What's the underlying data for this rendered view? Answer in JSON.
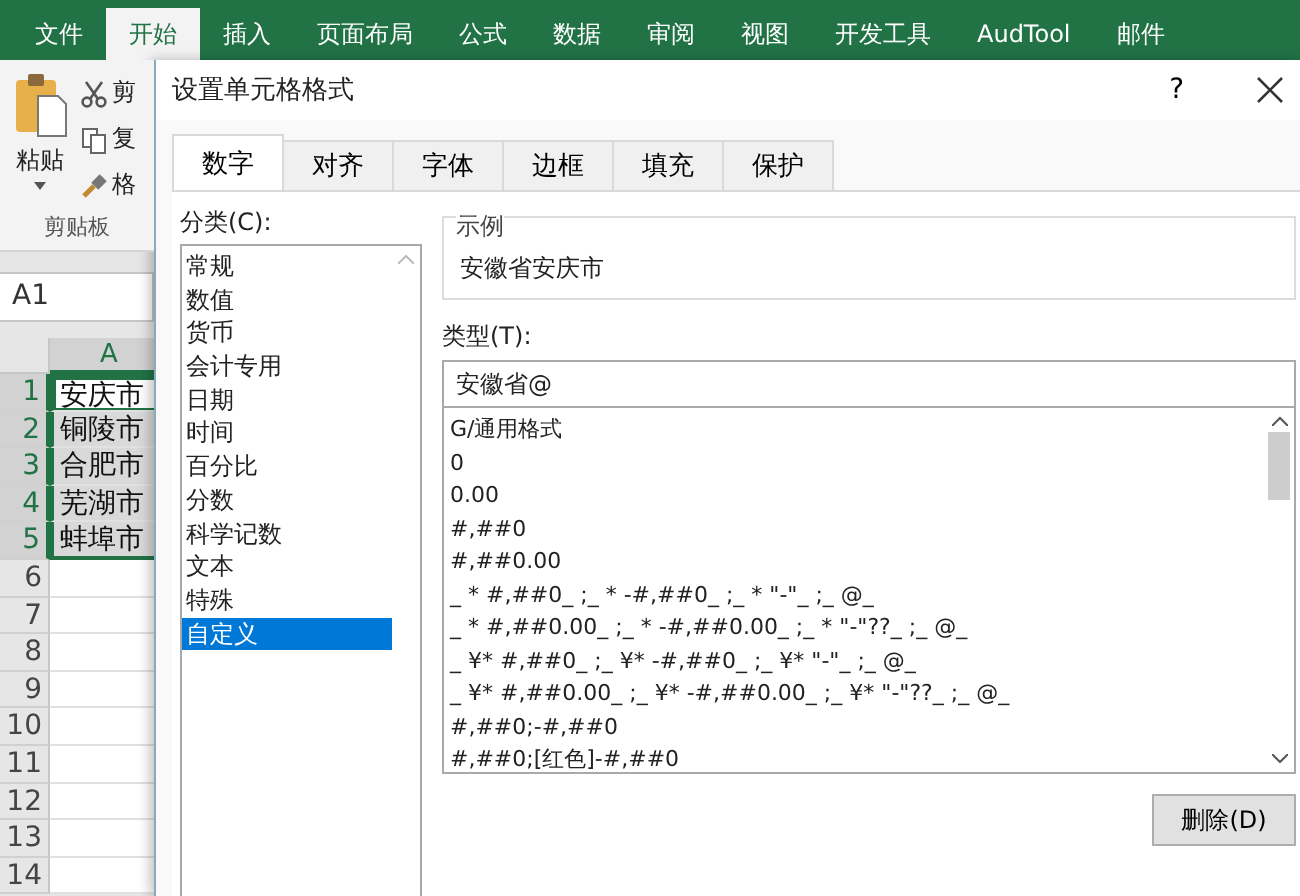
{
  "ribbon": {
    "tabs": [
      {
        "label": "文件",
        "selected": false
      },
      {
        "label": "开始",
        "selected": true
      },
      {
        "label": "插入",
        "selected": false
      },
      {
        "label": "页面布局",
        "selected": false
      },
      {
        "label": "公式",
        "selected": false
      },
      {
        "label": "数据",
        "selected": false
      },
      {
        "label": "审阅",
        "selected": false
      },
      {
        "label": "视图",
        "selected": false
      },
      {
        "label": "开发工具",
        "selected": false
      },
      {
        "label": "AudTool",
        "selected": false
      },
      {
        "label": "邮件",
        "selected": false
      }
    ],
    "clipboard": {
      "paste": "粘贴",
      "items": [
        {
          "kind": "cut",
          "label": "剪"
        },
        {
          "kind": "copy",
          "label": "复"
        },
        {
          "kind": "format",
          "label": "格"
        }
      ],
      "group": "剪贴板"
    }
  },
  "name_box": "A1",
  "sheet": {
    "column": "A",
    "rows": [
      {
        "number": "1",
        "value": "安庆市",
        "selected": true,
        "active": true
      },
      {
        "number": "2",
        "value": "铜陵市",
        "selected": true,
        "active": false
      },
      {
        "number": "3",
        "value": "合肥市",
        "selected": true,
        "active": false
      },
      {
        "number": "4",
        "value": "芜湖市",
        "selected": true,
        "active": false
      },
      {
        "number": "5",
        "value": "蚌埠市",
        "selected": true,
        "active": false
      },
      {
        "number": "6",
        "selected": false,
        "active": false
      },
      {
        "number": "7",
        "selected": false,
        "active": false
      },
      {
        "number": "8",
        "selected": false,
        "active": false
      },
      {
        "number": "9",
        "selected": false,
        "active": false
      },
      {
        "number": "10",
        "selected": false,
        "active": false
      },
      {
        "number": "11",
        "selected": false,
        "active": false
      },
      {
        "number": "12",
        "selected": false,
        "active": false
      },
      {
        "number": "13",
        "selected": false,
        "active": false
      },
      {
        "number": "14",
        "selected": false,
        "active": false
      }
    ]
  },
  "dialog": {
    "title": "设置单元格格式",
    "help": "?",
    "tabs": [
      {
        "label": "数字",
        "selected": true
      },
      {
        "label": "对齐",
        "selected": false
      },
      {
        "label": "字体",
        "selected": false
      },
      {
        "label": "边框",
        "selected": false
      },
      {
        "label": "填充",
        "selected": false
      },
      {
        "label": "保护",
        "selected": false
      }
    ],
    "category_label": "分类(C):",
    "categories": [
      {
        "label": "常规",
        "selected": false
      },
      {
        "label": "数值",
        "selected": false
      },
      {
        "label": "货币",
        "selected": false
      },
      {
        "label": "会计专用",
        "selected": false
      },
      {
        "label": "日期",
        "selected": false
      },
      {
        "label": "时间",
        "selected": false
      },
      {
        "label": "百分比",
        "selected": false
      },
      {
        "label": "分数",
        "selected": false
      },
      {
        "label": "科学记数",
        "selected": false
      },
      {
        "label": "文本",
        "selected": false
      },
      {
        "label": "特殊",
        "selected": false
      },
      {
        "label": "自定义",
        "selected": true
      }
    ],
    "sample": {
      "title": "示例",
      "value": "安徽省安庆市"
    },
    "type_label": "类型(T):",
    "type_value": "安徽省@",
    "formats": [
      "G/通用格式",
      "0",
      "0.00",
      "#,##0",
      "#,##0.00",
      "_ * #,##0_ ;_ * -#,##0_ ;_ * \"-\"_ ;_ @_",
      "_ * #,##0.00_ ;_ * -#,##0.00_ ;_ * \"-\"??_ ;_ @_",
      "_ ¥* #,##0_ ;_ ¥* -#,##0_ ;_ ¥* \"-\"_ ;_ @_",
      "_ ¥* #,##0.00_ ;_ ¥* -#,##0.00_ ;_ ¥* \"-\"??_ ;_ @_",
      "#,##0;-#,##0",
      "#,##0;[红色]-#,##0"
    ],
    "delete_button": "删除(D)"
  }
}
